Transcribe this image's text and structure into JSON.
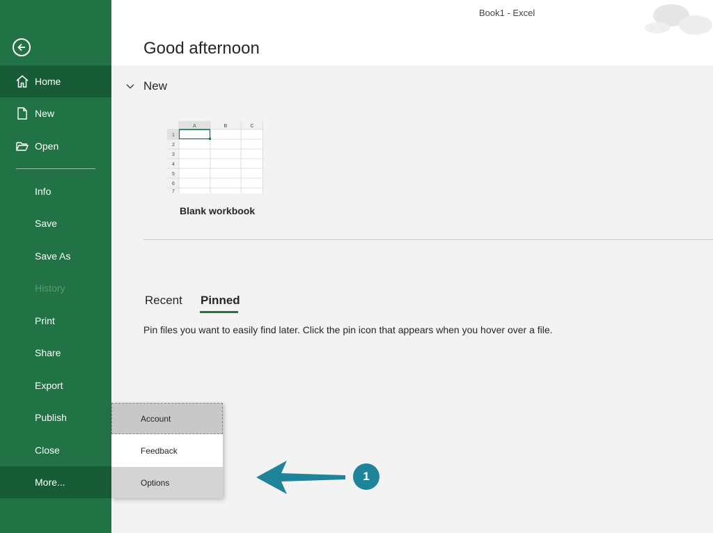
{
  "window": {
    "title": "Book1  -  Excel"
  },
  "header": {
    "greeting": "Good afternoon"
  },
  "sidebar": {
    "items": [
      {
        "label": "Home",
        "icon": "home-icon"
      },
      {
        "label": "New",
        "icon": "new-file-icon"
      },
      {
        "label": "Open",
        "icon": "open-folder-icon"
      },
      {
        "label": "Info"
      },
      {
        "label": "Save"
      },
      {
        "label": "Save As"
      },
      {
        "label": "History"
      },
      {
        "label": "Print"
      },
      {
        "label": "Share"
      },
      {
        "label": "Export"
      },
      {
        "label": "Publish"
      },
      {
        "label": "Close"
      },
      {
        "label": "More..."
      }
    ]
  },
  "new_section": {
    "title": "New",
    "template_label": "Blank workbook",
    "sheet": {
      "columns": [
        "A",
        "B",
        "C"
      ],
      "rows": [
        "1",
        "2",
        "3",
        "4",
        "5",
        "6",
        "7"
      ]
    }
  },
  "files": {
    "tabs": [
      "Recent",
      "Pinned"
    ],
    "active_tab": "Pinned",
    "pinned_message": "Pin files you want to easily find later. Click the pin icon that appears when you hover over a file."
  },
  "more_menu": {
    "items": [
      "Account",
      "Feedback",
      "Options"
    ]
  },
  "annotation": {
    "number": "1"
  },
  "colors": {
    "brand": "#217346",
    "brand_dark": "#185c37",
    "callout": "#1f8399"
  }
}
